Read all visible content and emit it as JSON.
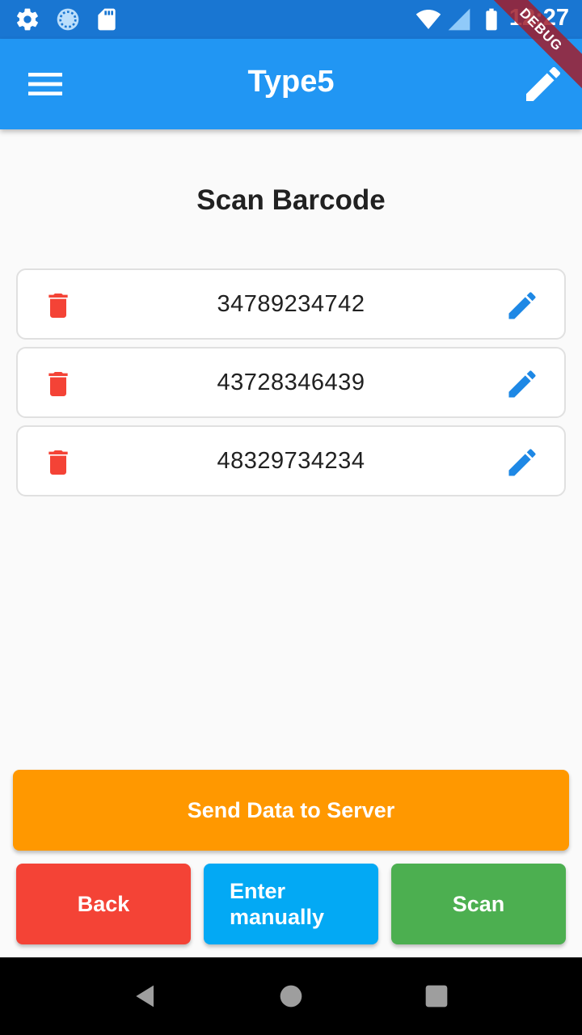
{
  "status_bar": {
    "time": "12:27",
    "icons": [
      "gear-icon",
      "sync-icon",
      "sd-card-icon",
      "wifi-icon",
      "signal-icon",
      "battery-icon"
    ]
  },
  "debug_banner": "DEBUG",
  "app_bar": {
    "title": "Type5",
    "menu_icon": "menu-icon",
    "edit_icon": "edit-icon"
  },
  "heading": "Scan Barcode",
  "barcodes": [
    {
      "code": "34789234742"
    },
    {
      "code": "43728346439"
    },
    {
      "code": "48329734234"
    }
  ],
  "buttons": {
    "send": "Send Data to Server",
    "back": "Back",
    "manual_line1": "Enter",
    "manual_line2": "manually",
    "scan": "Scan"
  },
  "colors": {
    "status_bar": "#1976d2",
    "app_bar": "#2196f3",
    "delete": "#f44336",
    "edit": "#1e88e5",
    "send": "#ff9800",
    "back": "#f44336",
    "manual": "#03a9f4",
    "scan": "#4caf50"
  }
}
